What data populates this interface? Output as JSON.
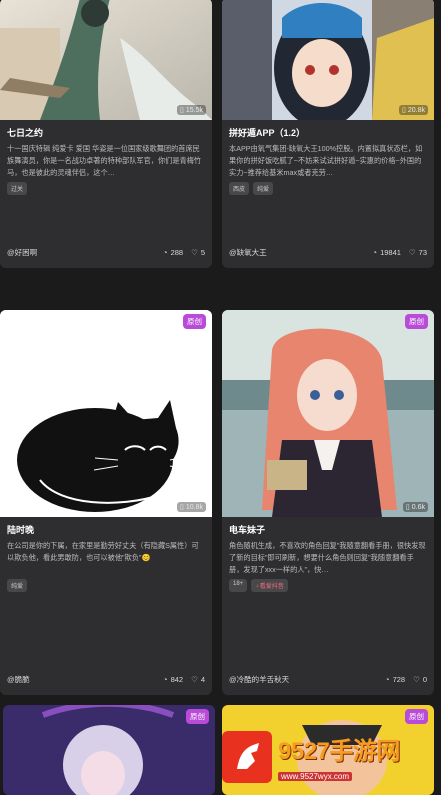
{
  "cards": [
    {
      "title": "七日之约",
      "views": "15.5k",
      "desc": "十一国庆特辑 纯爱卡 爱国 华姿是一位国家级歌舞团的首席民族舞演员，你是一名战功卓著的特种部队军官，你们是青梅竹马，也是彼此的灵魂伴侣，这个…",
      "tags": [
        "过关"
      ],
      "author": "@好困啊",
      "chats": "288",
      "likes": "5"
    },
    {
      "title": "拼好遁APP（1.2）",
      "views": "20.8k",
      "desc": "本APP由氧气集团-缺氧大王100%控股。内置拟真状态栏，如果你的拼好饭吃腻了~不妨来试试拼好遁~实惠的价格~外国的实力~推荐给基米max或者克劳…",
      "tags": [
        "西皮",
        "纯爱"
      ],
      "author": "@缺氧大王",
      "chats": "19841",
      "likes": "73"
    },
    {
      "title": "陆时晚",
      "views": "10.8k",
      "badge": "原创",
      "desc": "在公司是你的下属，在家里是勤劳好丈夫（有隐藏S属性）可以欺负他，看此男敢防，也可以被他\"欺负\"😊",
      "tags": [
        "纯爱"
      ],
      "author": "@脆脆",
      "chats": "842",
      "likes": "4"
    },
    {
      "title": "电车妹子",
      "views": "0.6k",
      "badge": "原创",
      "desc": "角色随机生成，不喜欢的角色回复\"我随意翻看手册，很快发现了新的目标\"即可刷新，想要什么角色则回复\"我随意翻看手册，发现了xxx一样的人\"，快…",
      "tags": [
        "18+",
        "♀看爱抖音"
      ],
      "author": "@冷酷的羊舌秋天",
      "chats": "728",
      "likes": "0"
    }
  ],
  "bottom_cards": [
    {
      "badge": "原创"
    },
    {
      "badge": "原创"
    }
  ],
  "watermark": {
    "main": "9527手游网",
    "url": "www.9527wyx.com"
  },
  "icons": {
    "views": "phone-icon",
    "chats": "chat-bubble-icon",
    "likes": "heart-icon"
  }
}
